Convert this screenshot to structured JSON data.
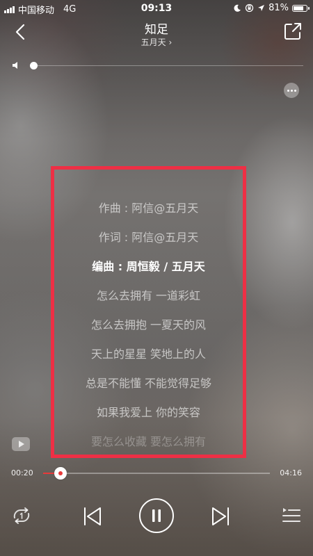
{
  "status_bar": {
    "carrier": "中国移动",
    "network": "4G",
    "time": "09:13",
    "battery": "81%",
    "battery_level": 0.81
  },
  "header": {
    "title": "知足",
    "artist": "五月天",
    "artist_chevron": "›"
  },
  "volume": {
    "level": 0.0
  },
  "lyrics": [
    {
      "text": "作曲 : 阿信@五月天",
      "state": "normal"
    },
    {
      "text": "作词 : 阿信@五月天",
      "state": "normal"
    },
    {
      "text": "编曲 : 周恒毅 / 五月天",
      "state": "current"
    },
    {
      "text": "怎么去拥有 一道彩虹",
      "state": "normal"
    },
    {
      "text": "怎么去拥抱 一夏天的风",
      "state": "normal"
    },
    {
      "text": "天上的星星 笑地上的人",
      "state": "normal"
    },
    {
      "text": "总是不能懂 不能觉得足够",
      "state": "normal"
    },
    {
      "text": "如果我爱上 你的笑容",
      "state": "normal"
    },
    {
      "text": "要怎么收藏 要怎么拥有",
      "state": "faded"
    }
  ],
  "highlight_color": "#ee2f45",
  "player": {
    "current_time": "00:20",
    "total_time": "04:16",
    "progress": 0.078,
    "accent_color": "#e83a3a"
  },
  "icons": {
    "back": "chevron-left-icon",
    "share": "share-icon",
    "volume": "speaker-icon",
    "more": "more-icon",
    "video": "video-play-icon",
    "repeat": "repeat-one-icon",
    "previous": "previous-track-icon",
    "pause": "pause-icon",
    "next": "next-track-icon",
    "playlist": "playlist-icon"
  }
}
